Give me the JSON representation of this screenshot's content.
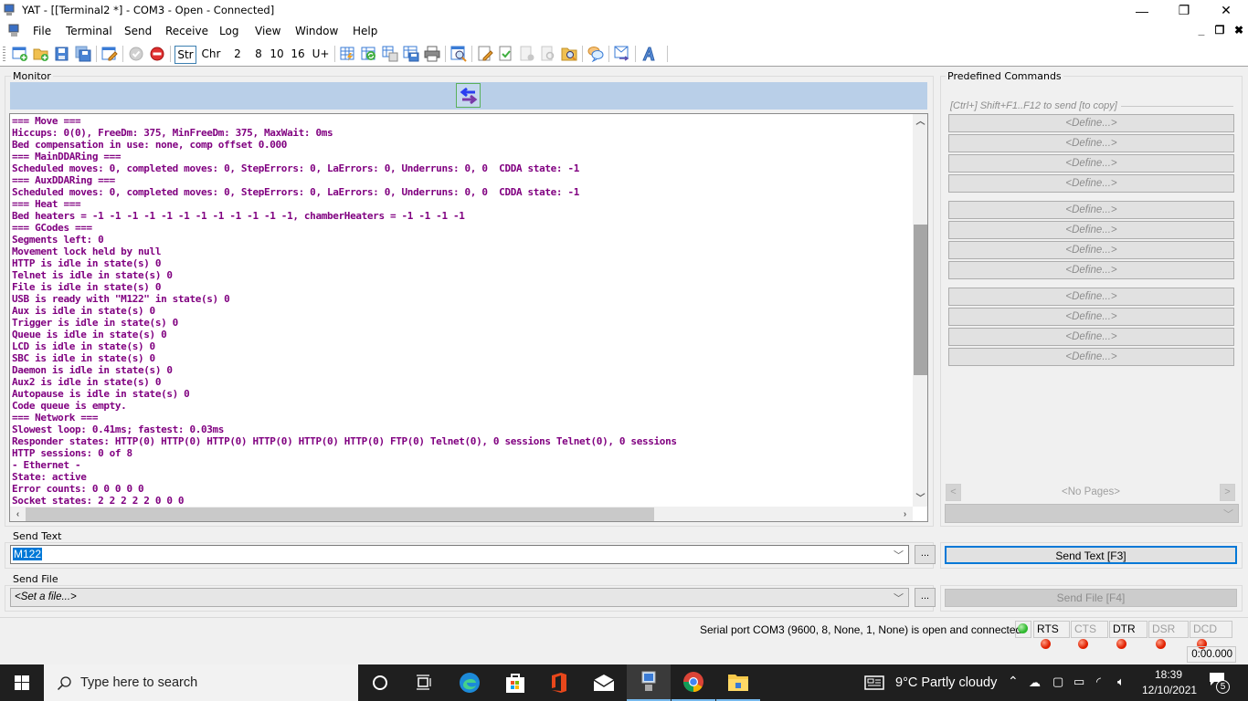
{
  "window": {
    "title": "YAT - [[Terminal2 *] - COM3 - Open - Connected]",
    "controls": {
      "minimize": "—",
      "maximize": "❐",
      "close": "✕"
    },
    "mdi_controls": {
      "minimize": "_",
      "restore": "❐",
      "close": "✖"
    }
  },
  "menu": {
    "items": [
      "File",
      "Terminal",
      "Send",
      "Receive",
      "Log",
      "View",
      "Window",
      "Help"
    ]
  },
  "toolbar": {
    "icons_left": [
      "new-terminal-icon",
      "open-terminal-icon",
      "save-icon",
      "save-as-icon",
      "edit-settings-icon"
    ],
    "icons_status": [
      "open-port-icon",
      "close-port-icon"
    ],
    "radix": [
      "Str",
      "Chr",
      "2",
      "8",
      "10",
      "16",
      "U+"
    ],
    "radix_active": "Str",
    "icons_right": [
      "show-predefined-icon",
      "refresh-icon",
      "copy-icon",
      "save-to-file-icon",
      "print-icon",
      "find-icon",
      "log-settings-icon",
      "log-on-icon",
      "log-off-icon",
      "log-view-icon",
      "log-folder-icon",
      "comment-icon",
      "send-receive-icon",
      "format-icon"
    ]
  },
  "monitor": {
    "label": "Monitor",
    "lines": [
      "=== Move ===",
      "Hiccups: 0(0), FreeDm: 375, MinFreeDm: 375, MaxWait: 0ms",
      "Bed compensation in use: none, comp offset 0.000",
      "=== MainDDARing ===",
      "Scheduled moves: 0, completed moves: 0, StepErrors: 0, LaErrors: 0, Underruns: 0, 0  CDDA state: -1",
      "=== AuxDDARing ===",
      "Scheduled moves: 0, completed moves: 0, StepErrors: 0, LaErrors: 0, Underruns: 0, 0  CDDA state: -1",
      "=== Heat ===",
      "Bed heaters = -1 -1 -1 -1 -1 -1 -1 -1 -1 -1 -1 -1, chamberHeaters = -1 -1 -1 -1",
      "=== GCodes ===",
      "Segments left: 0",
      "Movement lock held by null",
      "HTTP is idle in state(s) 0",
      "Telnet is idle in state(s) 0",
      "File is idle in state(s) 0",
      "USB is ready with \"M122\" in state(s) 0",
      "Aux is idle in state(s) 0",
      "Trigger is idle in state(s) 0",
      "Queue is idle in state(s) 0",
      "LCD is idle in state(s) 0",
      "SBC is idle in state(s) 0",
      "Daemon is idle in state(s) 0",
      "Aux2 is idle in state(s) 0",
      "Autopause is idle in state(s) 0",
      "Code queue is empty.",
      "=== Network ===",
      "Slowest loop: 0.41ms; fastest: 0.03ms",
      "Responder states: HTTP(0) HTTP(0) HTTP(0) HTTP(0) HTTP(0) HTTP(0) FTP(0) Telnet(0), 0 sessions Telnet(0), 0 sessions",
      "HTTP sessions: 0 of 8",
      "- Ethernet -",
      "State: active",
      "Error counts: 0 0 0 0 0",
      "Socket states: 2 2 2 2 2 0 0 0"
    ],
    "vscroll_position": 0.45,
    "hscroll_position": 0.0,
    "text_color": "#800080"
  },
  "predefined": {
    "label": "Predefined Commands",
    "hint": "[Ctrl+] Shift+F1..F12 to send [to copy]",
    "commands": [
      "<Define...>",
      "<Define...>",
      "<Define...>",
      "<Define...>",
      "<Define...>",
      "<Define...>",
      "<Define...>",
      "<Define...>",
      "<Define...>",
      "<Define...>",
      "<Define...>",
      "<Define...>"
    ],
    "pager_label": "<No Pages>",
    "prev": "<",
    "next": ">"
  },
  "send_text": {
    "label": "Send Text",
    "value": "M122",
    "more": "...",
    "button": "Send Text [F3]"
  },
  "send_file": {
    "label": "Send File",
    "value": "<Set a file...>",
    "more": "...",
    "button": "Send File [F4]"
  },
  "status": {
    "message": "Serial port COM3 (9600, 8, None, 1, None) is open and connected",
    "connection_led": "#2db82d",
    "signals": [
      {
        "name": "RTS",
        "enabled": true,
        "color": "#e02000"
      },
      {
        "name": "CTS",
        "enabled": false,
        "color": "#e02000"
      },
      {
        "name": "DTR",
        "enabled": true,
        "color": "#e02000"
      },
      {
        "name": "DSR",
        "enabled": false,
        "color": "#e02000"
      },
      {
        "name": "DCD",
        "enabled": false,
        "color": "#e02000"
      }
    ],
    "timer": "0:00.000"
  },
  "taskbar": {
    "search_placeholder": "Type here to search",
    "weather": "9°C  Partly cloudy",
    "time": "18:39",
    "date": "12/10/2021",
    "notifications": "5"
  }
}
